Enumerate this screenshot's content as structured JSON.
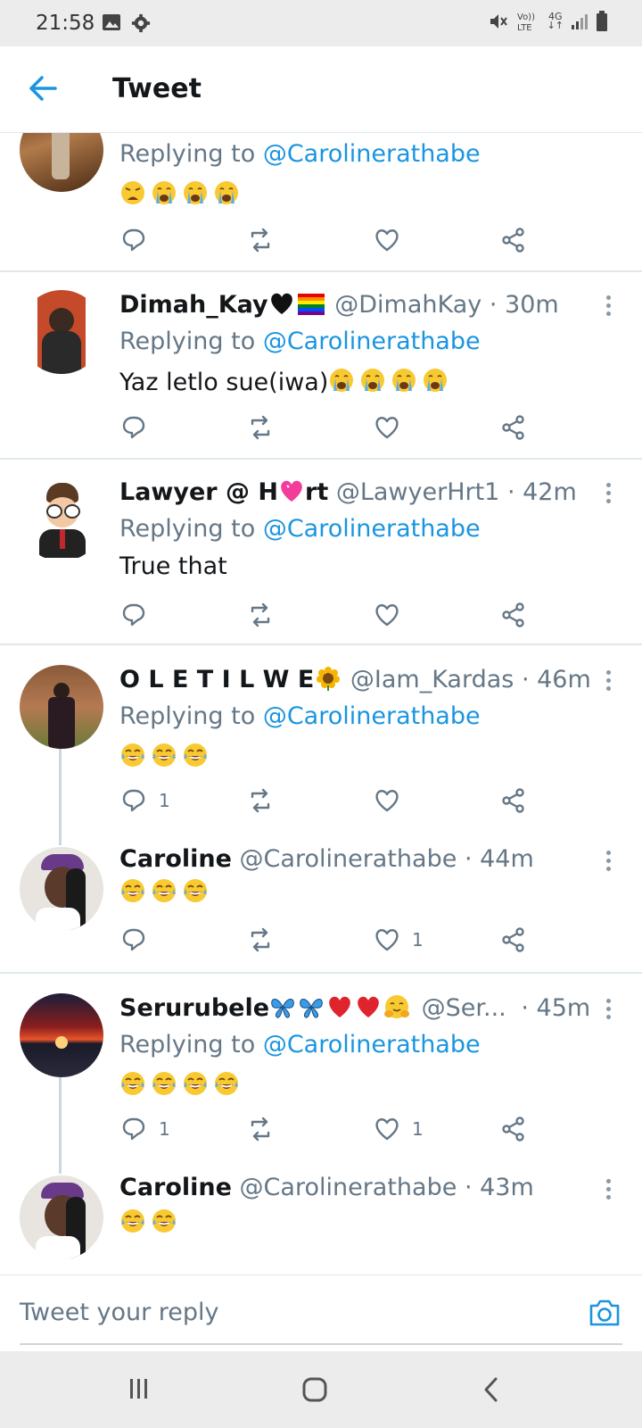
{
  "status": {
    "time": "21:58",
    "network": "4G"
  },
  "header": {
    "title": "Tweet"
  },
  "tweets": [
    {
      "name": "",
      "handle": "",
      "time": "",
      "replying_label": "Replying to",
      "replying_to": "@Carolinerathabe",
      "text": "",
      "reply_count": "",
      "like_count": ""
    },
    {
      "name": "Dimah_Kay",
      "handle": "@DimahKay",
      "time": "· 30m",
      "replying_label": "Replying to",
      "replying_to": "@Carolinerathabe",
      "text": "Yaz letlo sue(iwa)",
      "reply_count": "",
      "like_count": ""
    },
    {
      "name_a": "Lawyer @ H",
      "name_b": "rt",
      "handle": "@LawyerHrt1",
      "time": "· 42m",
      "replying_label": "Replying to",
      "replying_to": "@Carolinerathabe",
      "text": "True that",
      "reply_count": "",
      "like_count": ""
    },
    {
      "name": "O L E T I L W E",
      "handle": "@Iam_Kardas",
      "time": "· 46m",
      "replying_label": "Replying to",
      "replying_to": "@Carolinerathabe",
      "text": "",
      "reply_count": "1",
      "like_count": ""
    },
    {
      "name": "Caroline",
      "handle": "@Carolinerathabe",
      "time": "· 44m",
      "text": "",
      "reply_count": "",
      "like_count": "1"
    },
    {
      "name": "Serurubele",
      "handle": "@Ser...",
      "time": "· 45m",
      "replying_label": "Replying to",
      "replying_to": "@Carolinerathabe",
      "text": "",
      "reply_count": "1",
      "like_count": "1"
    },
    {
      "name": "Caroline",
      "handle": "@Carolinerathabe",
      "time": "· 43m",
      "text": ""
    }
  ],
  "reply_bar": {
    "placeholder": "Tweet your reply"
  },
  "icons": {
    "back": "arrow-left-icon",
    "reply": "comment-icon",
    "retweet": "retweet-icon",
    "like": "heart-icon",
    "share": "share-icon",
    "more": "more-vertical-icon",
    "camera": "camera-icon"
  },
  "colors": {
    "accent": "#1b95e0",
    "text": "#14171a",
    "secondary": "#657786",
    "divider": "#e1e8ed"
  }
}
